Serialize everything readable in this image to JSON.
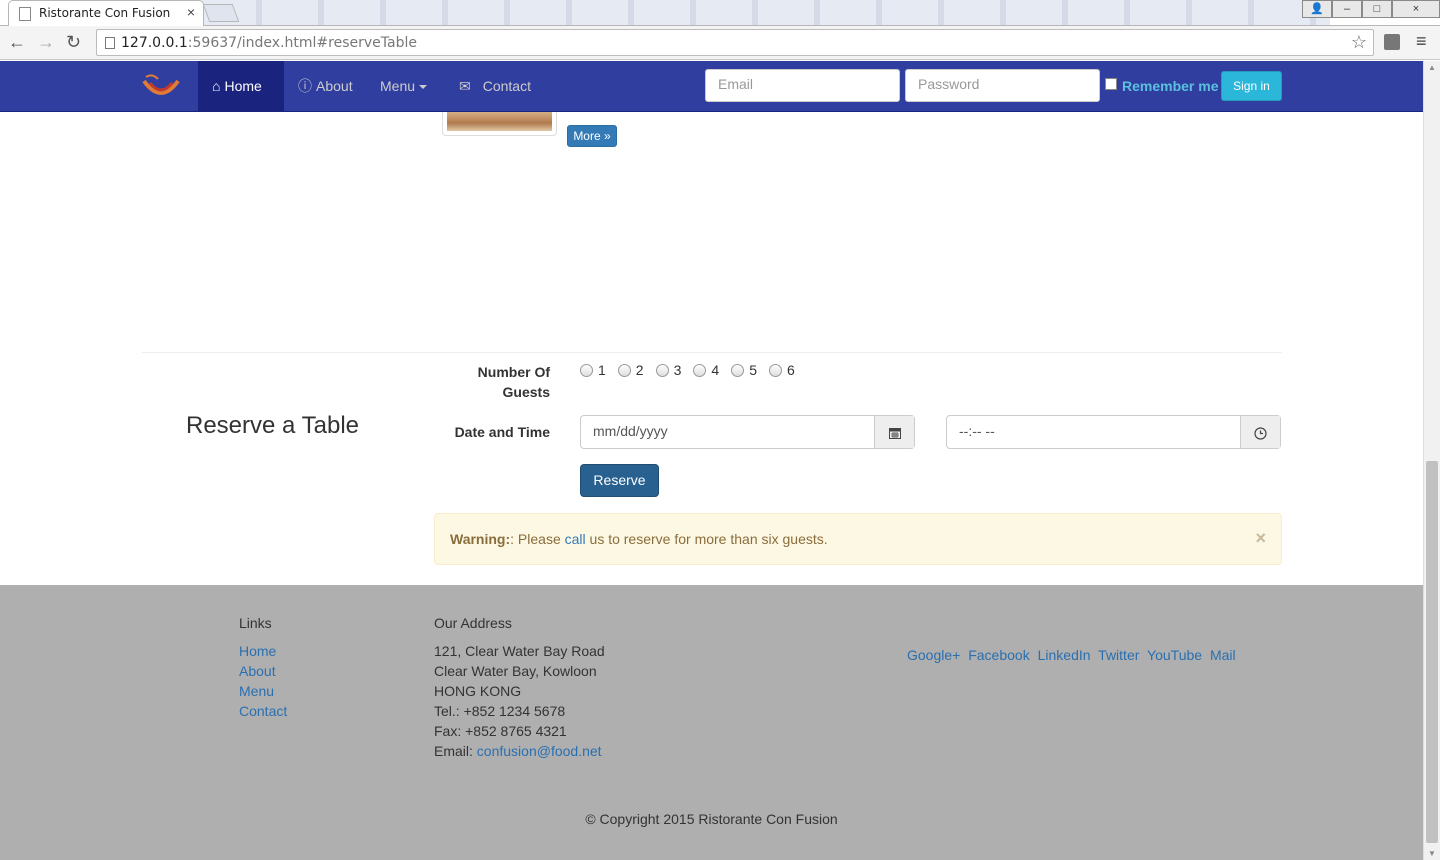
{
  "browser": {
    "tab_title": "Ristorante Con Fusion",
    "tab_close": "×",
    "url_host": "127.0.0.1",
    "url_rest": ":59637/index.html#reserveTable",
    "back": "←",
    "forward": "→",
    "reload": "↻",
    "star": "☆",
    "menu": "≡",
    "win_min": "–",
    "win_max": "□",
    "win_close": "×"
  },
  "navbar": {
    "home": "Home",
    "about": "About",
    "menu": "Menu",
    "contact": "Contact",
    "email_placeholder": "Email",
    "password_placeholder": "Password",
    "remember": "Remember me",
    "signin": "Sign in"
  },
  "leader": {
    "more_label": "More »"
  },
  "reserve": {
    "title": "Reserve a Table",
    "guests_label_1": "Number Of",
    "guests_label_2": "Guests",
    "guests": [
      "1",
      "2",
      "3",
      "4",
      "5",
      "6"
    ],
    "datetime_label": "Date and Time",
    "date_placeholder": "mm/dd/yyyy",
    "time_placeholder": "--:-- --",
    "calendar_icon": "calendar-icon",
    "clock_icon": "clock-icon",
    "button": "Reserve",
    "warning_strong": "Warning:",
    "warning_pre": ": Please ",
    "warning_link": "call",
    "warning_post": " us to reserve for more than six guests.",
    "close": "×"
  },
  "footer": {
    "links_heading": "Links",
    "links": [
      "Home",
      "About",
      "Menu",
      "Contact"
    ],
    "address_heading": "Our Address",
    "address_lines": [
      "121, Clear Water Bay Road",
      "Clear Water Bay, Kowloon",
      "HONG KONG",
      "Tel.: +852 1234 5678",
      "Fax: +852 8765 4321"
    ],
    "email_label": "Email: ",
    "email": "confusion@food.net",
    "social": [
      "Google+",
      "Facebook",
      "LinkedIn",
      "Twitter",
      "YouTube",
      "Mail"
    ],
    "copyright": "© Copyright 2015 Ristorante Con Fusion"
  }
}
